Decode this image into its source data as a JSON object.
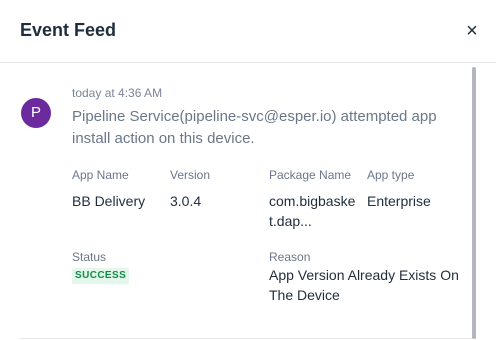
{
  "header": {
    "title": "Event Feed",
    "close_glyph": "×",
    "close_icon": "close-icon"
  },
  "event": {
    "avatar_letter": "P",
    "timestamp": "today at 4:36 AM",
    "message": "Pipeline Service(pipeline-svc@esper.io) attempted app install action on this device.",
    "fields": {
      "app_name": {
        "label": "App Name",
        "value": "BB Delivery"
      },
      "version": {
        "label": "Version",
        "value": "3.0.4"
      },
      "package_name": {
        "label": "Package Name",
        "value_line1": "com.bigbaske",
        "value_line2": "t.dap..."
      },
      "app_type": {
        "label": "App type",
        "value": "Enterprise"
      },
      "status": {
        "label": "Status",
        "value": "SUCCESS"
      },
      "reason": {
        "label": "Reason",
        "value": "App Version Already Exists On The Device"
      }
    }
  },
  "colors": {
    "avatar": "#6b2a9e",
    "success_bg": "#e3f7ea",
    "success_text": "#138a48"
  }
}
